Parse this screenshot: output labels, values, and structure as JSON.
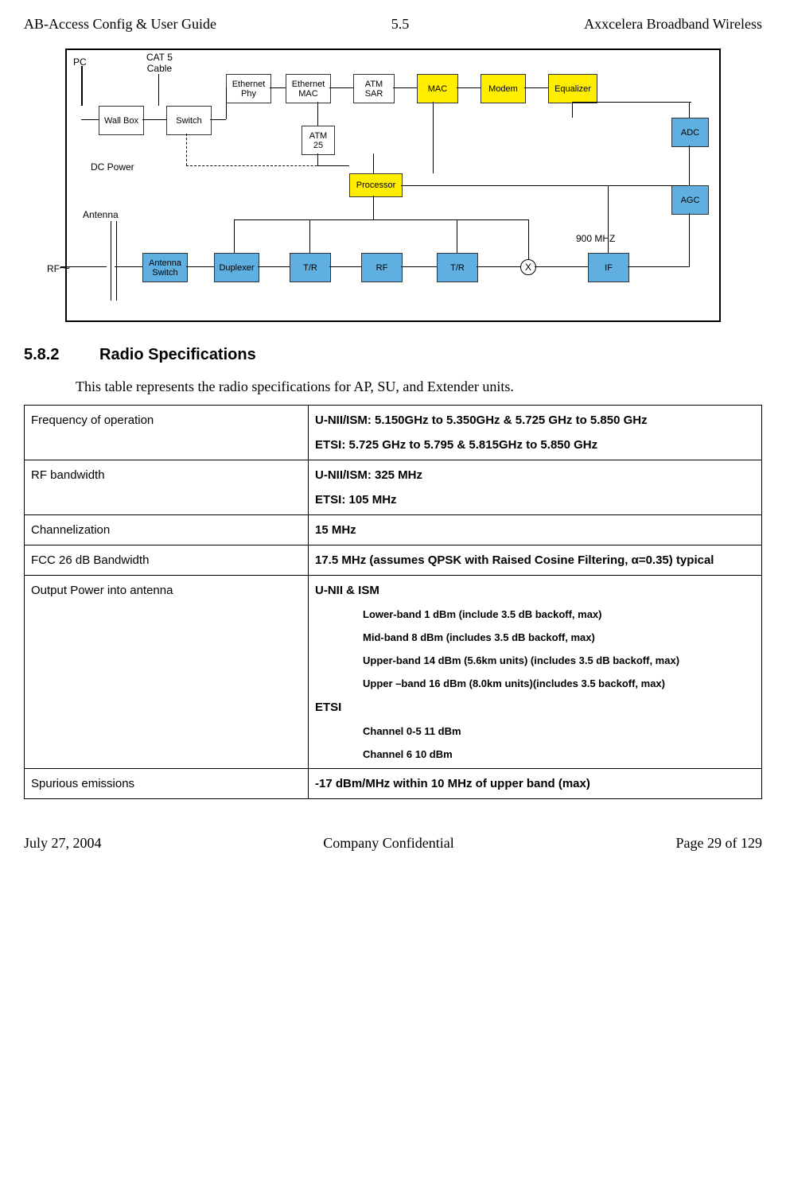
{
  "header": {
    "left": "AB-Access Config & User Guide",
    "center": "5.5",
    "right": "Axxcelera Broadband Wireless"
  },
  "diagram": {
    "labels": {
      "pc": "PC",
      "cat5": "CAT 5\nCable",
      "dcpower": "DC Power",
      "antenna": "Antenna",
      "rf": "RF",
      "mhz900": "900 MHZ"
    },
    "boxes": {
      "wallbox": "Wall Box",
      "switch": "Switch",
      "ethphy": "Ethernet\nPhy",
      "ethmac": "Ethernet\nMAC",
      "atmsar": "ATM\nSAR",
      "mac": "MAC",
      "modem": "Modem",
      "equalizer": "Equalizer",
      "atm25": "ATM\n25",
      "processor": "Processor",
      "adc": "ADC",
      "agc": "AGC",
      "antswitch": "Antenna\nSwitch",
      "duplexer": "Duplexer",
      "tr1": "T/R",
      "rfblock": "RF",
      "tr2": "T/R",
      "ifblock": "IF",
      "x": "X"
    }
  },
  "section": {
    "number": "5.8.2",
    "title": "Radio Specifications",
    "intro": "This table represents the radio specifications for AP, SU, and Extender units."
  },
  "table": {
    "rows": [
      {
        "label": "Frequency of operation",
        "value_lines": [
          "U-NII/ISM: 5.150GHz to 5.350GHz & 5.725 GHz  to 5.850 GHz",
          "ETSI: 5.725 GHz to 5.795 & 5.815GHz to 5.850 GHz"
        ]
      },
      {
        "label": "RF bandwidth",
        "value_lines": [
          "U-NII/ISM: 325 MHz",
          "ETSI: 105 MHz"
        ]
      },
      {
        "label": "Channelization",
        "value_lines": [
          "15 MHz"
        ]
      },
      {
        "label": "FCC 26 dB Bandwidth",
        "value_lines": [
          "17.5 MHz (assumes QPSK with Raised Cosine Filtering, α=0.35) typical"
        ],
        "justify": true
      },
      {
        "label": "Output Power into antenna",
        "heading1": "U-NII & ISM",
        "sub1": [
          "Lower-band 1 dBm (include 3.5 dB backoff, max)",
          "Mid-band 8 dBm (includes 3.5 dB backoff, max)",
          "Upper-band 14 dBm (5.6km units) (includes 3.5 dB backoff, max)",
          "Upper –band 16 dBm (8.0km units)(includes 3.5 backoff, max)"
        ],
        "heading2": "ETSI",
        "sub2": [
          "Channel 0-5  11 dBm",
          "Channel 6  10 dBm"
        ]
      },
      {
        "label": "Spurious emissions",
        "value_lines": [
          "-17 dBm/MHz within 10 MHz of upper band (max)"
        ]
      }
    ]
  },
  "footer": {
    "left": "July 27, 2004",
    "center": "Company Confidential",
    "right": "Page 29 of 129"
  }
}
